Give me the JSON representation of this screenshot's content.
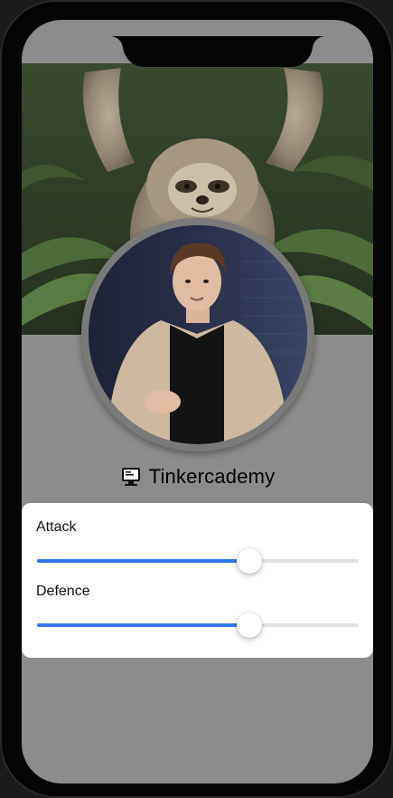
{
  "profile": {
    "username": "Tinkercademy",
    "username_icon": "computer-icon",
    "cover_image": "sloth-photo",
    "avatar_image": "profile-photo"
  },
  "stats": [
    {
      "label": "Attack",
      "value": 0.66,
      "min": 0,
      "max": 1
    },
    {
      "label": "Defence",
      "value": 0.66,
      "min": 0,
      "max": 1
    }
  ],
  "colors": {
    "slider_fill": "#3478f6",
    "slider_track": "#e2e2e2",
    "background": "#8c8c8c",
    "card": "#ffffff"
  }
}
